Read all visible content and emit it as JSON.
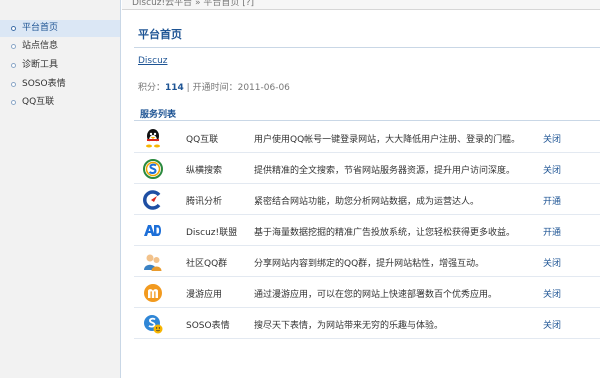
{
  "breadcrumb": "Discuz!云平台 » 平台首页 [?]",
  "sidebar": {
    "items": [
      {
        "label": "平台首页",
        "active": true
      },
      {
        "label": "站点信息",
        "active": false
      },
      {
        "label": "诊断工具",
        "active": false
      },
      {
        "label": "SOSO表情",
        "active": false
      },
      {
        "label": "QQ互联",
        "active": false
      }
    ]
  },
  "main": {
    "title": "平台首页",
    "user": "Discuz",
    "stats": {
      "points_label": "积分：",
      "points_value": "114",
      "separator": " | ",
      "open_label": "开通时间：",
      "open_date": "2011-06-06"
    },
    "services_title": "服务列表",
    "services": [
      {
        "name": "QQ互联",
        "icon": "qq-penguin-icon",
        "desc": "用户使用QQ帐号一键登录网站，大大降低用户注册、登录的门槛。",
        "action": "关闭"
      },
      {
        "name": "纵横搜索",
        "icon": "search-s-icon",
        "desc": "提供精准的全文搜索，节省网站服务器资源，提升用户访问深度。",
        "action": "关闭"
      },
      {
        "name": "腾讯分析",
        "icon": "analytics-c-icon",
        "desc": "紧密结合网站功能，助您分析网站数据，成为运营达人。",
        "action": "开通"
      },
      {
        "name": "Discuz!联盟",
        "icon": "ad-union-icon",
        "desc": "基于海量数据挖掘的精准广告投放系统，让您轻松获得更多收益。",
        "action": "开通"
      },
      {
        "name": "社区QQ群",
        "icon": "qq-group-icon",
        "desc": "分享网站内容到绑定的QQ群，提升网站粘性，增强互动。",
        "action": "关闭"
      },
      {
        "name": "漫游应用",
        "icon": "manyou-m-icon",
        "desc": "通过漫游应用，可以在您的网站上快速部署数百个优秀应用。",
        "action": "关闭"
      },
      {
        "name": "SOSO表情",
        "icon": "soso-emoticon-icon",
        "desc": "搜尽天下表情，为网站带来无穷的乐趣与体验。",
        "action": "关闭"
      }
    ]
  },
  "colors": {
    "link": "#1e5494",
    "sidebar_bg": "#f2f2f2",
    "active_bg": "#dbe7f5",
    "rule": "#c9d7e6"
  }
}
